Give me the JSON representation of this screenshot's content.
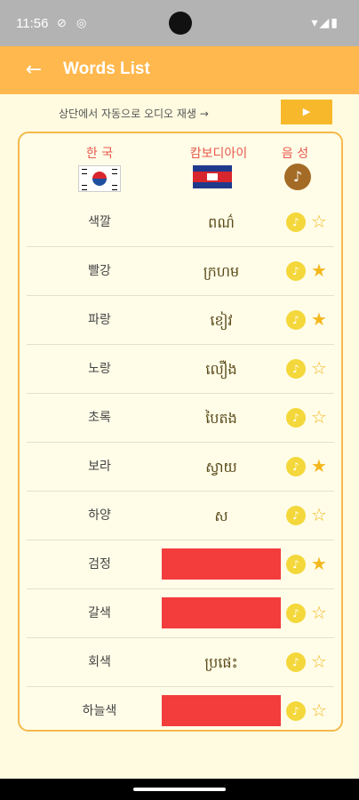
{
  "status_bar": {
    "time": "11:56"
  },
  "app_bar": {
    "title": "Words List"
  },
  "auto_play": {
    "text": "상단에서 자동으로 오디오 재생 →",
    "button": "▶"
  },
  "headers": {
    "korean": "한 국",
    "khmer": "캄보디아이",
    "sound": "음 성"
  },
  "words": [
    {
      "ko": "색깔",
      "kh": "ពណ៌",
      "hidden": false,
      "favorite": false
    },
    {
      "ko": "빨강",
      "kh": "ក្រហម",
      "hidden": false,
      "favorite": true
    },
    {
      "ko": "파랑",
      "kh": "ខៀវ",
      "hidden": false,
      "favorite": true
    },
    {
      "ko": "노랑",
      "kh": "លឿង",
      "hidden": false,
      "favorite": false
    },
    {
      "ko": "초록",
      "kh": "បៃតង",
      "hidden": false,
      "favorite": false
    },
    {
      "ko": "보라",
      "kh": "ស្វាយ",
      "hidden": false,
      "favorite": true
    },
    {
      "ko": "하양",
      "kh": "ស",
      "hidden": false,
      "favorite": false
    },
    {
      "ko": "검정",
      "kh": "",
      "hidden": true,
      "favorite": true
    },
    {
      "ko": "갈색",
      "kh": "",
      "hidden": true,
      "favorite": false
    },
    {
      "ko": "회색",
      "kh": "ប្រផេះ",
      "hidden": false,
      "favorite": false
    },
    {
      "ko": "하늘색",
      "kh": "",
      "hidden": true,
      "favorite": false
    }
  ],
  "colors": {
    "accent": "#ffb84d",
    "hidden_block": "#f33c3c",
    "star": "#f4b81f",
    "sound": "#f4d73a"
  }
}
